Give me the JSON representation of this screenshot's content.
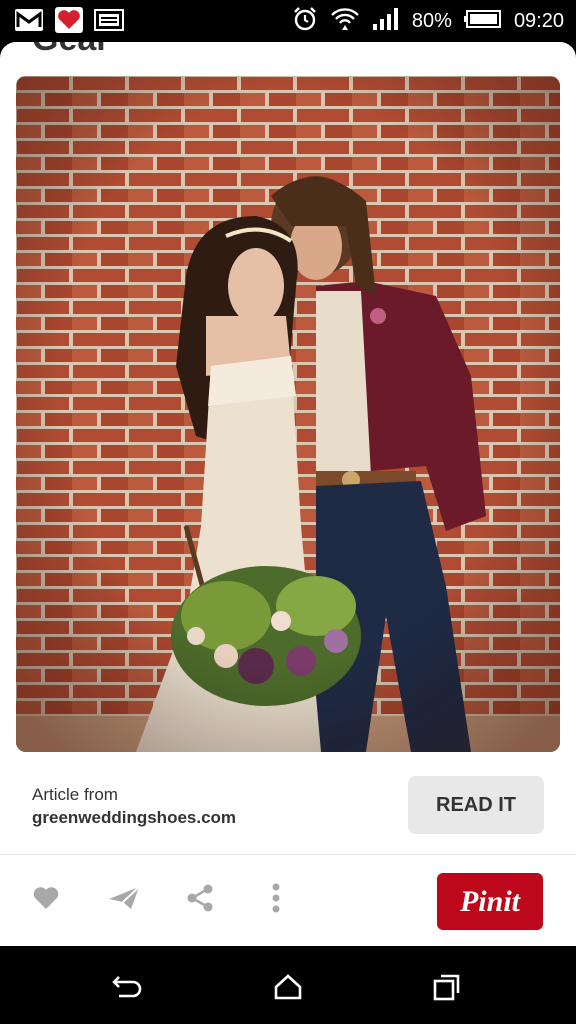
{
  "status_bar": {
    "battery": "80%",
    "time": "09:20",
    "icons": [
      "gmail-icon",
      "heart-app-icon",
      "screenshot-icon",
      "alarm-icon",
      "wifi-icon",
      "signal-icon",
      "battery-icon"
    ]
  },
  "card": {
    "previous_title_fragment": "Gear",
    "image_alt": "Bride and groom against a red brick wall",
    "article_label": "Article from",
    "article_source": "greenweddingshoes.com",
    "read_button": "READ IT",
    "pin_button": "Pinit"
  },
  "actions": [
    "heart-icon",
    "send-icon",
    "share-icon",
    "more-icon"
  ],
  "nav": [
    "back-icon",
    "home-icon",
    "recents-icon"
  ],
  "colors": {
    "pin_red": "#bd081c",
    "read_button_bg": "#e8e8e8",
    "icon_gray": "#a8a8a8",
    "brick": "#b5553a"
  }
}
